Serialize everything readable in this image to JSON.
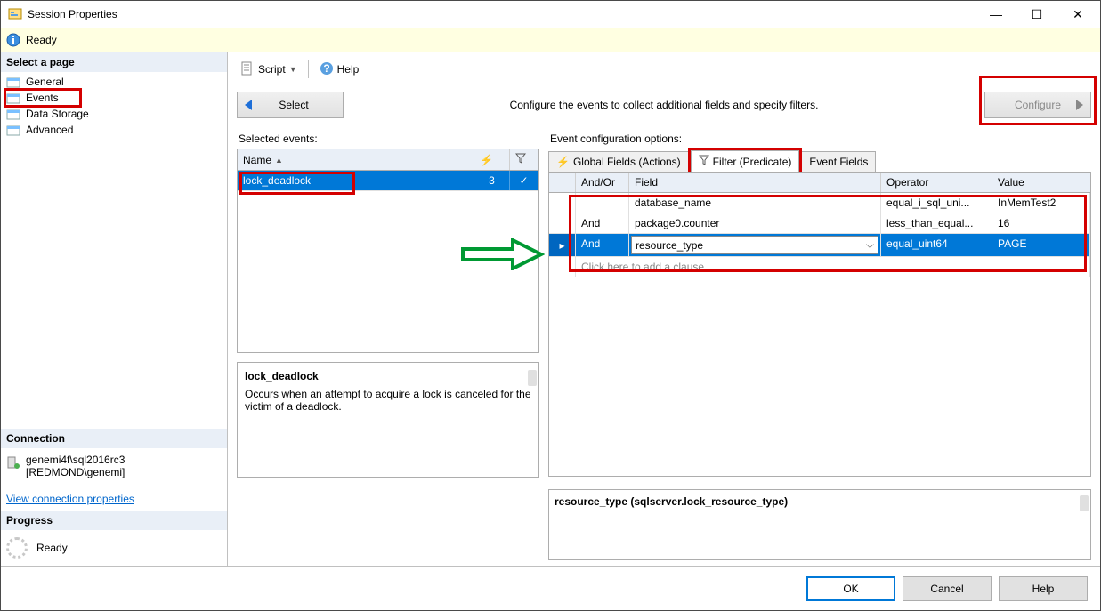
{
  "window": {
    "title": "Session Properties",
    "minimize": "—",
    "maximize": "☐",
    "close": "✕"
  },
  "infobar": {
    "text": "Ready"
  },
  "sidebar": {
    "select_page": "Select a page",
    "pages": [
      {
        "label": "General"
      },
      {
        "label": "Events"
      },
      {
        "label": "Data Storage"
      },
      {
        "label": "Advanced"
      }
    ],
    "connection_header": "Connection",
    "connection_line1": "genemi4f\\sql2016rc3",
    "connection_line2": "[REDMOND\\genemi]",
    "view_conn_link": "View connection properties",
    "progress_header": "Progress",
    "progress_text": "Ready"
  },
  "toolbar": {
    "script": "Script",
    "help": "Help"
  },
  "config_header": {
    "select_btn": "Select",
    "desc": "Configure the events to collect additional fields and specify filters.",
    "configure_btn": "Configure"
  },
  "selected_events": {
    "label": "Selected events:",
    "columns": {
      "name": "Name"
    },
    "rows": [
      {
        "name": "lock_deadlock",
        "count": "3",
        "check": "✓"
      }
    ]
  },
  "event_desc": {
    "title": "lock_deadlock",
    "body": "Occurs when an attempt to acquire a lock is canceled for the victim of a deadlock."
  },
  "event_config": {
    "label": "Event configuration options:",
    "tabs": {
      "global": "Global Fields (Actions)",
      "filter": "Filter (Predicate)",
      "fields": "Event Fields"
    },
    "columns": {
      "andor": "And/Or",
      "field": "Field",
      "operator": "Operator",
      "value": "Value"
    },
    "rows": [
      {
        "andor": "",
        "field": "database_name",
        "operator": "equal_i_sql_uni...",
        "value": "InMemTest2"
      },
      {
        "andor": "And",
        "field": "package0.counter",
        "operator": "less_than_equal...",
        "value": "16"
      },
      {
        "andor": "And",
        "field": "resource_type",
        "operator": "equal_uint64",
        "value": "PAGE"
      }
    ],
    "hint": "Click here to add a clause",
    "detail": "resource_type (sqlserver.lock_resource_type)"
  },
  "footer": {
    "ok": "OK",
    "cancel": "Cancel",
    "help": "Help"
  }
}
